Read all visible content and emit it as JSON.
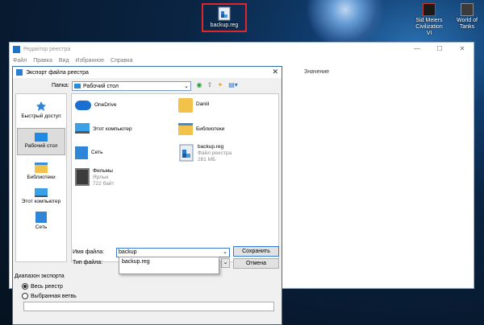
{
  "desktop": {
    "file_icon_label": "backup.reg",
    "civ_label": "Sid Meiers Civilization VI",
    "wot_label": "World of Tanks"
  },
  "registry": {
    "title": "Редактор реестра",
    "menu": [
      "Файл",
      "Правка",
      "Вид",
      "Избранное",
      "Справка"
    ],
    "column_value": "Значение"
  },
  "dialog": {
    "title": "Экспорт файла реестра",
    "look_in_label": "Папка:",
    "look_in_value": "Рабочий стол",
    "places": [
      {
        "label": "Быстрый доступ"
      },
      {
        "label": "Рабочий стол"
      },
      {
        "label": "Библиотеки"
      },
      {
        "label": "Этот компьютер"
      },
      {
        "label": "Сеть"
      }
    ],
    "files": [
      {
        "name": "OneDrive",
        "sub": ""
      },
      {
        "name": "Daniil",
        "sub": ""
      },
      {
        "name": "Этот компьютер",
        "sub": ""
      },
      {
        "name": "Библиотеки",
        "sub": ""
      },
      {
        "name": "Сеть",
        "sub": ""
      },
      {
        "name": "backup.reg",
        "sub1": "Файл реестра",
        "sub2": "281 МБ"
      },
      {
        "name": "Фильмы",
        "sub1": "Ярлык",
        "sub2": "722 байт"
      }
    ],
    "filename_label": "Имя файла:",
    "filename_value": "backup",
    "filetype_label": "Тип файла:",
    "autocomplete_option": "backup.reg",
    "save_label": "Сохранить",
    "cancel_label": "Отмена",
    "range_title": "Диапазон экспорта",
    "radio_all": "Весь реестр",
    "radio_branch": "Выбранная ветвь",
    "colors": {
      "accent": "#2f7bd6",
      "folder": "#f3c24a"
    }
  }
}
